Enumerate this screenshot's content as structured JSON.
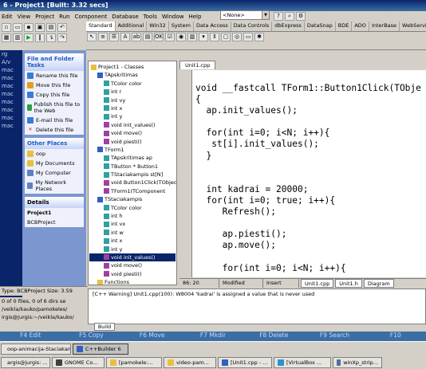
{
  "window": {
    "title": "6 - Project1 [Built: 3.32 secs]"
  },
  "menu": [
    "Edit",
    "View",
    "Project",
    "Run",
    "Component",
    "Database",
    "Tools",
    "Window",
    "Help"
  ],
  "combo": {
    "value": "<None>"
  },
  "palette_tabs": [
    "Standard",
    "Additional",
    "Win32",
    "System",
    "Data Access",
    "Data Controls",
    "dbExpress",
    "DataSnap",
    "BDE",
    "ADO",
    "InterBase",
    "WebServices"
  ],
  "left_sidebar": [
    "rg",
    "A/v",
    "mac",
    "mac",
    "mac",
    "mac",
    "mac",
    "mac",
    "mac",
    "mac"
  ],
  "file_tasks": {
    "header": "File and Folder Tasks",
    "items": [
      "Rename this file",
      "Move this file",
      "Copy this file",
      "Publish this file to the Web",
      "E-mail this file",
      "Delete this file"
    ]
  },
  "other_places": {
    "header": "Other Places",
    "items": [
      "oop",
      "My Documents",
      "My Computer",
      "My Network Places"
    ]
  },
  "details": {
    "header": "Details",
    "name": "Project1",
    "type": "BCBProject"
  },
  "status_left": "Type: BCBProject Size: 3.59",
  "class_explorer": {
    "title": "Project1 - Classes",
    "nodes": [
      {
        "text": "Project1 - Classes",
        "indent": 0,
        "icon": "folder"
      },
      {
        "text": "TApskritimas",
        "indent": 1,
        "icon": "class"
      },
      {
        "text": "TColor color",
        "indent": 2,
        "icon": "field"
      },
      {
        "text": "int r",
        "indent": 2,
        "icon": "field"
      },
      {
        "text": "int vy",
        "indent": 2,
        "icon": "field"
      },
      {
        "text": "int x",
        "indent": 2,
        "icon": "field"
      },
      {
        "text": "int y",
        "indent": 2,
        "icon": "field"
      },
      {
        "text": "void init_values()",
        "indent": 2,
        "icon": "method"
      },
      {
        "text": "void move()",
        "indent": 2,
        "icon": "method"
      },
      {
        "text": "void piesti()",
        "indent": 2,
        "icon": "method"
      },
      {
        "text": "TForm1",
        "indent": 1,
        "icon": "class"
      },
      {
        "text": "TApskritimas ap",
        "indent": 2,
        "icon": "field"
      },
      {
        "text": "TButton * Button1",
        "indent": 2,
        "icon": "field"
      },
      {
        "text": "TStaciakampis st[N]",
        "indent": 2,
        "icon": "field"
      },
      {
        "text": "void Button1Click(TObject",
        "indent": 2,
        "icon": "method"
      },
      {
        "text": "TForm1(TComponent",
        "indent": 2,
        "icon": "method"
      },
      {
        "text": "TStaciakampis",
        "indent": 1,
        "icon": "class"
      },
      {
        "text": "TColor color",
        "indent": 2,
        "icon": "field"
      },
      {
        "text": "int h",
        "indent": 2,
        "icon": "field"
      },
      {
        "text": "int vx",
        "indent": 2,
        "icon": "field"
      },
      {
        "text": "int w",
        "indent": 2,
        "icon": "field"
      },
      {
        "text": "int x",
        "indent": 2,
        "icon": "field"
      },
      {
        "text": "int y",
        "indent": 2,
        "icon": "field"
      },
      {
        "text": "void init_values()",
        "indent": 2,
        "icon": "method",
        "selected": true
      },
      {
        "text": "void move()",
        "indent": 2,
        "icon": "method"
      },
      {
        "text": "void piesti()",
        "indent": 2,
        "icon": "method"
      },
      {
        "text": "Functions",
        "indent": 1,
        "icon": "folder"
      }
    ]
  },
  "editor": {
    "tab": "Unit1.cpp",
    "lines": [
      "void __fastcall TForm1::Button1Click(TObje",
      "{",
      "  ap.init_values();",
      "",
      "  for(int i=0; i<N; i++){",
      "   st[i].init_values();",
      "  }",
      "",
      "",
      "  int kadrai = 20000;",
      "  for(int i=0; true; i++){",
      "     Refresh();",
      "",
      "     ap.piesti();",
      "     ap.move();",
      "",
      "     for(int i=0; i<N; i++){"
    ]
  },
  "editor_status": {
    "position": "86: 20",
    "state": "Modified",
    "mode": "Insert",
    "tabs": [
      "Unit1.cpp",
      "Unit1.h",
      "Diagram"
    ]
  },
  "messages": {
    "text": "[C++ Warning] Unit1.cpp(100): W8004 'kadrai' is assigned a value that is never used",
    "tab": "Build"
  },
  "left_bottom": [
    "0 of 0 files, 0 of 6 dirs se",
    "/veikla/kauko/pamokeles/",
    "irgis@jurgis:~/veikla/kauko/"
  ],
  "fkeys": [
    "F4 Edit",
    "F5 Copy",
    "F6 Move",
    "F7 Mkdir",
    "F8 Delete",
    "F9 Search",
    "F10"
  ],
  "taskbar": {
    "row1": [
      "oop-animacija-Staciakam",
      "C++Builder 6"
    ],
    "row2": [
      "argis@jurgis: ...",
      "GNOME Co...",
      "[pamokele:...",
      "video-pam...",
      "[Unit1.cpp - ...",
      "[VirtualBox ...",
      "winXp_strip..."
    ]
  }
}
